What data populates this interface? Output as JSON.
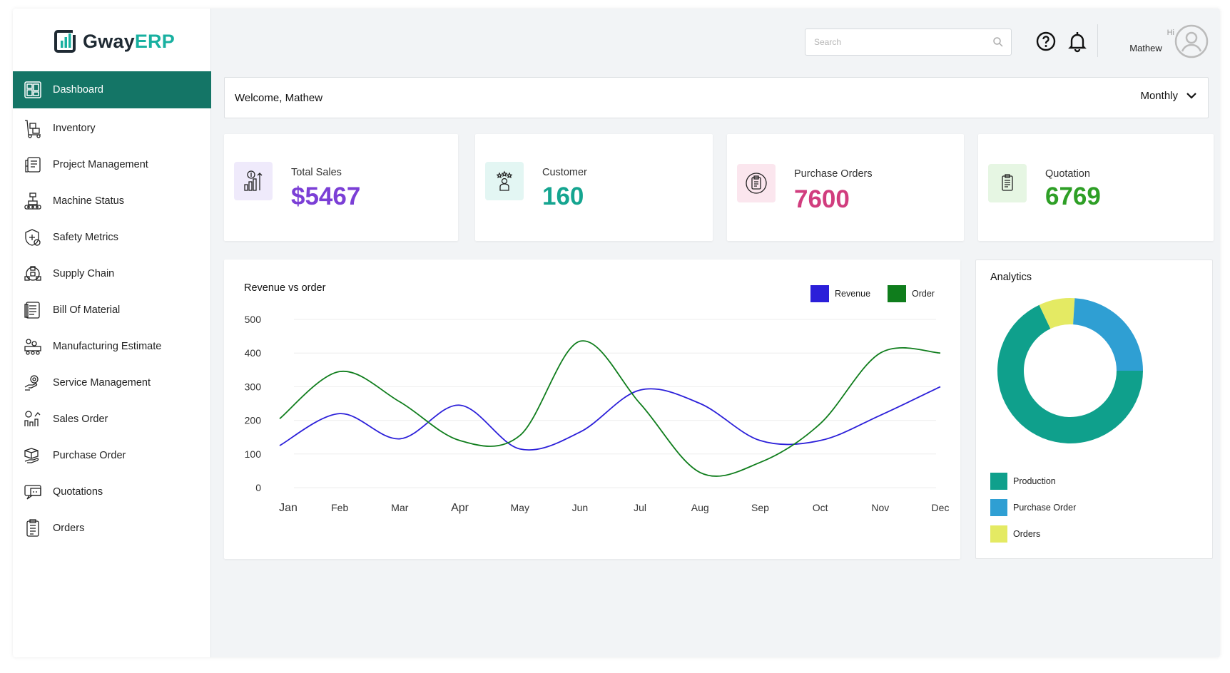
{
  "brand": {
    "part1": "Gway",
    "part2": "ERP"
  },
  "sidebar": {
    "items": [
      {
        "label": "Dashboard",
        "icon": "dashboard-icon"
      },
      {
        "label": "Inventory",
        "icon": "inventory-icon"
      },
      {
        "label": "Project Management",
        "icon": "project-management-icon"
      },
      {
        "label": "Machine Status",
        "icon": "machine-status-icon"
      },
      {
        "label": "Safety Metrics",
        "icon": "safety-metrics-icon"
      },
      {
        "label": "Supply Chain",
        "icon": "supply-chain-icon"
      },
      {
        "label": "Bill Of Material",
        "icon": "bill-of-material-icon"
      },
      {
        "label": "Manufacturing Estimate",
        "icon": "manufacturing-estimate-icon"
      },
      {
        "label": "Service Management",
        "icon": "service-management-icon"
      },
      {
        "label": "Sales Order",
        "icon": "sales-order-icon"
      },
      {
        "label": "Purchase Order",
        "icon": "purchase-order-icon"
      },
      {
        "label": "Quotations",
        "icon": "quotations-icon"
      },
      {
        "label": "Orders",
        "icon": "orders-icon"
      }
    ],
    "active": "Dashboard"
  },
  "header": {
    "search_placeholder": "Search",
    "greeting": "Hi",
    "user_name": "Mathew"
  },
  "welcome": {
    "text": "Welcome, Mathew",
    "period": "Monthly"
  },
  "stats": [
    {
      "label": "Total Sales",
      "value": "$5467",
      "color": "#7b3fd6",
      "bg": "#efeafb"
    },
    {
      "label": "Customer",
      "value": "160",
      "color": "#15a590",
      "bg": "#e3f6f3"
    },
    {
      "label": "Purchase Orders",
      "value": "7600",
      "color": "#d13d7e",
      "bg": "#fbe6ee"
    },
    {
      "label": "Quotation",
      "value": "6769",
      "color": "#2e9f26",
      "bg": "#e6f6e3"
    }
  ],
  "chart_data": [
    {
      "type": "line",
      "title": "Revenue vs order",
      "categories": [
        "Jan",
        "Feb",
        "Mar",
        "Apr",
        "May",
        "Jun",
        "Jul",
        "Aug",
        "Sep",
        "Oct",
        "Nov",
        "Dec"
      ],
      "tick_labels": [
        "Jan",
        "Feb",
        "Mar",
        "Apr",
        "May",
        "Jun",
        "Jul",
        "Aug",
        "Sep",
        "Oct",
        "Nov",
        "Dec"
      ],
      "ylim": [
        0,
        500
      ],
      "yticks": [
        0,
        100,
        200,
        300,
        400,
        500
      ],
      "grid": true,
      "legend_position": "top-right",
      "series": [
        {
          "name": "Revenue",
          "color": "#2b1fd9",
          "values": [
            125,
            220,
            145,
            245,
            115,
            165,
            290,
            250,
            140,
            140,
            215,
            300
          ]
        },
        {
          "name": "Order",
          "color": "#0f7d1c",
          "values": [
            205,
            345,
            255,
            140,
            155,
            435,
            250,
            45,
            75,
            190,
            400,
            400
          ]
        }
      ]
    },
    {
      "type": "pie",
      "title": "Analytics",
      "legend_position": "bottom-left",
      "labels": [
        "Production",
        "Purchase Order",
        "Orders"
      ],
      "values": [
        68,
        24,
        8
      ],
      "colors": [
        "#0fa08c",
        "#2f9fd3",
        "#e4ea63"
      ]
    }
  ]
}
